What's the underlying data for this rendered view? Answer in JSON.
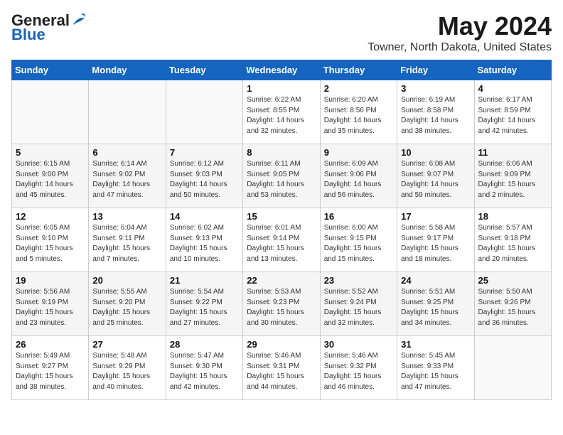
{
  "logo": {
    "general": "General",
    "blue": "Blue"
  },
  "title": "May 2024",
  "location": "Towner, North Dakota, United States",
  "headers": [
    "Sunday",
    "Monday",
    "Tuesday",
    "Wednesday",
    "Thursday",
    "Friday",
    "Saturday"
  ],
  "weeks": [
    [
      {
        "day": "",
        "info": ""
      },
      {
        "day": "",
        "info": ""
      },
      {
        "day": "",
        "info": ""
      },
      {
        "day": "1",
        "info": "Sunrise: 6:22 AM\nSunset: 8:55 PM\nDaylight: 14 hours\nand 32 minutes."
      },
      {
        "day": "2",
        "info": "Sunrise: 6:20 AM\nSunset: 8:56 PM\nDaylight: 14 hours\nand 35 minutes."
      },
      {
        "day": "3",
        "info": "Sunrise: 6:19 AM\nSunset: 8:58 PM\nDaylight: 14 hours\nand 38 minutes."
      },
      {
        "day": "4",
        "info": "Sunrise: 6:17 AM\nSunset: 8:59 PM\nDaylight: 14 hours\nand 42 minutes."
      }
    ],
    [
      {
        "day": "5",
        "info": "Sunrise: 6:15 AM\nSunset: 9:00 PM\nDaylight: 14 hours\nand 45 minutes."
      },
      {
        "day": "6",
        "info": "Sunrise: 6:14 AM\nSunset: 9:02 PM\nDaylight: 14 hours\nand 47 minutes."
      },
      {
        "day": "7",
        "info": "Sunrise: 6:12 AM\nSunset: 9:03 PM\nDaylight: 14 hours\nand 50 minutes."
      },
      {
        "day": "8",
        "info": "Sunrise: 6:11 AM\nSunset: 9:05 PM\nDaylight: 14 hours\nand 53 minutes."
      },
      {
        "day": "9",
        "info": "Sunrise: 6:09 AM\nSunset: 9:06 PM\nDaylight: 14 hours\nand 56 minutes."
      },
      {
        "day": "10",
        "info": "Sunrise: 6:08 AM\nSunset: 9:07 PM\nDaylight: 14 hours\nand 59 minutes."
      },
      {
        "day": "11",
        "info": "Sunrise: 6:06 AM\nSunset: 9:09 PM\nDaylight: 15 hours\nand 2 minutes."
      }
    ],
    [
      {
        "day": "12",
        "info": "Sunrise: 6:05 AM\nSunset: 9:10 PM\nDaylight: 15 hours\nand 5 minutes."
      },
      {
        "day": "13",
        "info": "Sunrise: 6:04 AM\nSunset: 9:11 PM\nDaylight: 15 hours\nand 7 minutes."
      },
      {
        "day": "14",
        "info": "Sunrise: 6:02 AM\nSunset: 9:13 PM\nDaylight: 15 hours\nand 10 minutes."
      },
      {
        "day": "15",
        "info": "Sunrise: 6:01 AM\nSunset: 9:14 PM\nDaylight: 15 hours\nand 13 minutes."
      },
      {
        "day": "16",
        "info": "Sunrise: 6:00 AM\nSunset: 9:15 PM\nDaylight: 15 hours\nand 15 minutes."
      },
      {
        "day": "17",
        "info": "Sunrise: 5:58 AM\nSunset: 9:17 PM\nDaylight: 15 hours\nand 18 minutes."
      },
      {
        "day": "18",
        "info": "Sunrise: 5:57 AM\nSunset: 9:18 PM\nDaylight: 15 hours\nand 20 minutes."
      }
    ],
    [
      {
        "day": "19",
        "info": "Sunrise: 5:56 AM\nSunset: 9:19 PM\nDaylight: 15 hours\nand 23 minutes."
      },
      {
        "day": "20",
        "info": "Sunrise: 5:55 AM\nSunset: 9:20 PM\nDaylight: 15 hours\nand 25 minutes."
      },
      {
        "day": "21",
        "info": "Sunrise: 5:54 AM\nSunset: 9:22 PM\nDaylight: 15 hours\nand 27 minutes."
      },
      {
        "day": "22",
        "info": "Sunrise: 5:53 AM\nSunset: 9:23 PM\nDaylight: 15 hours\nand 30 minutes."
      },
      {
        "day": "23",
        "info": "Sunrise: 5:52 AM\nSunset: 9:24 PM\nDaylight: 15 hours\nand 32 minutes."
      },
      {
        "day": "24",
        "info": "Sunrise: 5:51 AM\nSunset: 9:25 PM\nDaylight: 15 hours\nand 34 minutes."
      },
      {
        "day": "25",
        "info": "Sunrise: 5:50 AM\nSunset: 9:26 PM\nDaylight: 15 hours\nand 36 minutes."
      }
    ],
    [
      {
        "day": "26",
        "info": "Sunrise: 5:49 AM\nSunset: 9:27 PM\nDaylight: 15 hours\nand 38 minutes."
      },
      {
        "day": "27",
        "info": "Sunrise: 5:48 AM\nSunset: 9:29 PM\nDaylight: 15 hours\nand 40 minutes."
      },
      {
        "day": "28",
        "info": "Sunrise: 5:47 AM\nSunset: 9:30 PM\nDaylight: 15 hours\nand 42 minutes."
      },
      {
        "day": "29",
        "info": "Sunrise: 5:46 AM\nSunset: 9:31 PM\nDaylight: 15 hours\nand 44 minutes."
      },
      {
        "day": "30",
        "info": "Sunrise: 5:46 AM\nSunset: 9:32 PM\nDaylight: 15 hours\nand 46 minutes."
      },
      {
        "day": "31",
        "info": "Sunrise: 5:45 AM\nSunset: 9:33 PM\nDaylight: 15 hours\nand 47 minutes."
      },
      {
        "day": "",
        "info": ""
      }
    ]
  ]
}
